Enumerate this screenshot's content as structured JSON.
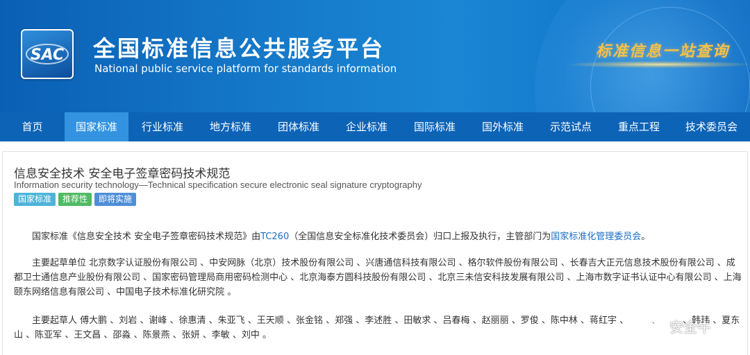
{
  "header": {
    "logo_text": "SAC",
    "title_cn": "全国标准信息公共服务平台",
    "title_en": "National public service platform  for standards information",
    "slogan": "标准信息一站查询"
  },
  "nav": {
    "items": [
      {
        "label": "首页"
      },
      {
        "label": "国家标准"
      },
      {
        "label": "行业标准"
      },
      {
        "label": "地方标准"
      },
      {
        "label": "团体标准"
      },
      {
        "label": "企业标准"
      },
      {
        "label": "国际标准"
      },
      {
        "label": "国外标准"
      },
      {
        "label": "示范试点"
      },
      {
        "label": "重点工程"
      },
      {
        "label": "技术委员会"
      }
    ],
    "active_index": 1
  },
  "standard": {
    "title_cn": "信息安全技术 安全电子签章密码技术规范",
    "title_en": "Information security technology—Technical specification secure electronic seal signature cryptography",
    "badges": [
      "国家标准",
      "推荐性",
      "即将实施"
    ]
  },
  "paragraph1": {
    "text_before": "国家标准《信息安全技术 安全电子签章密码技术规范》由",
    "tc_link": "TC260",
    "text_middle": "（全国信息安全标准化技术委员会）归口上报及执行，主管部门为",
    "admin_link": "国家标准化管理委员会",
    "text_after": "。"
  },
  "paragraph2": {
    "label": "主要起草单位",
    "text": " 北京数字认证股份有限公司 、中安网脉（北京）技术股份有限公司 、兴唐通信科技有限公司 、格尔软件股份有限公司 、长春吉大正元信息技术股份有限公司 、成都卫士通信息产业股份有限公司 、国家密码管理局商用密码检测中心 、北京海泰方圆科技股份有限公司 、北京三未信安科技发展有限公司 、上海市数字证书认证中心有限公司 、上海颐东网络信息有限公司 、中国电子技术标准化研究院 。"
  },
  "paragraph3": {
    "label": "主要起草人",
    "text": " 傅大鹏 、刘岩 、谢峰 、徐惠清 、朱亚飞 、王天顺 、张金铭 、郑强 、李述胜 、田敏求 、吕春梅 、赵丽丽 、罗俊 、陈中林 、蒋红宇 、　　　、　　　、韩玮 、夏东山 、陈亚军 、王文昌 、邵淼 、陈景燕 、张妍 、李敏 、刘中 。"
  },
  "watermark": {
    "text": "安全牛"
  },
  "colors": {
    "banner": "#1578c8",
    "nav": "#0d63b6",
    "nav_active": "#3393e0",
    "link": "#1a6fc4",
    "badge_national": "#4fb3d8",
    "badge_recommended": "#4fbb63",
    "badge_upcoming": "#4f8fd8"
  }
}
